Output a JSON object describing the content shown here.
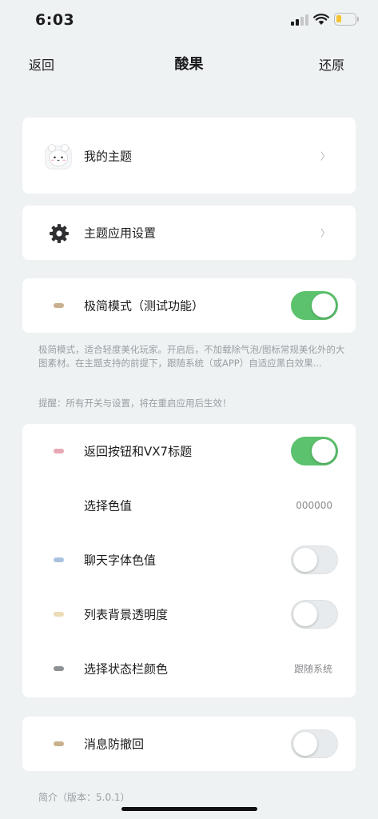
{
  "status_bar": {
    "time": "6:03"
  },
  "nav": {
    "back": "返回",
    "title": "酸果",
    "reset": "还原"
  },
  "my_theme": {
    "label": "我的主题",
    "chevron": "〉"
  },
  "theme_settings": {
    "label": "主题应用设置",
    "chevron": "〉"
  },
  "minimal_mode": {
    "label": "极简模式（测试功能）",
    "enabled": true
  },
  "notes": {
    "minimal_desc": "极简模式，适合轻度美化玩家。开启后，不加载除气泡/图标常规美化外的大图素材。在主题支持的前提下，跟随系统（或APP）自适应黑白效果...",
    "reminder": "提醒：所有开关与设置，将在重启应用后生效！",
    "intro": "简介（版本：5.0.1）"
  },
  "settings": {
    "back_button": {
      "label": "返回按钮和VX7标题",
      "enabled": true
    },
    "pick_color": {
      "label": "选择色值",
      "value": "000000"
    },
    "chat_font_color": {
      "label": "聊天字体色值",
      "enabled": false
    },
    "list_bg_opacity": {
      "label": "列表背景透明度",
      "enabled": false
    },
    "status_bar_color": {
      "label": "选择状态栏颜色",
      "value": "跟随系统"
    }
  },
  "anti_recall": {
    "label": "消息防撤回",
    "enabled": false
  },
  "colors": {
    "toggle_on": "#5cc26d",
    "dot_tan": "#c9b08e",
    "dot_pink": "#e8a8b4",
    "dot_blue": "#a9c3de",
    "dot_cream": "#ecdcb6",
    "dot_gray": "#8e9195"
  }
}
